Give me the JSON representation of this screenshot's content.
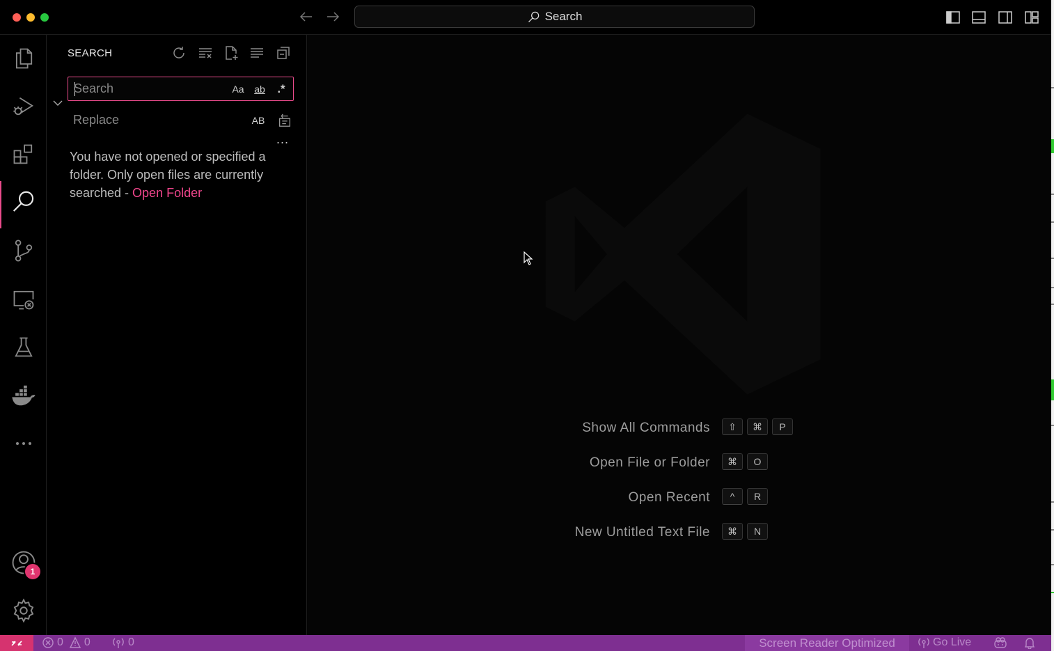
{
  "titlebar": {
    "command_center": "Search"
  },
  "activity_bar": {
    "items": [
      {
        "name": "explorer",
        "icon": "files-icon"
      },
      {
        "name": "run-debug",
        "icon": "debug-icon"
      },
      {
        "name": "extensions",
        "icon": "extensions-icon"
      },
      {
        "name": "search",
        "icon": "search-icon",
        "active": true
      },
      {
        "name": "source-control",
        "icon": "git-branch-icon"
      },
      {
        "name": "remote-explorer",
        "icon": "remote-icon"
      },
      {
        "name": "testing",
        "icon": "beaker-icon"
      },
      {
        "name": "docker",
        "icon": "docker-icon"
      },
      {
        "name": "more",
        "icon": "ellipsis-icon"
      }
    ],
    "accounts_badge": "1"
  },
  "sidebar": {
    "title": "SEARCH",
    "search": {
      "placeholder": "Search",
      "value": ""
    },
    "replace": {
      "placeholder": "Replace",
      "value": ""
    },
    "options": {
      "match_case": "Aa",
      "whole_word": "ab",
      "regex": ".*",
      "preserve_case": "AB"
    },
    "message_text": "You have not opened or specified a folder. Only open files are currently searched - ",
    "message_link": "Open Folder",
    "more": "..."
  },
  "editor": {
    "shortcuts": [
      {
        "label": "Show All Commands",
        "keys": [
          "⇧",
          "⌘",
          "P"
        ]
      },
      {
        "label": "Open File or Folder",
        "keys": [
          "⌘",
          "O"
        ]
      },
      {
        "label": "Open Recent",
        "keys": [
          "^",
          "R"
        ]
      },
      {
        "label": "New Untitled Text File",
        "keys": [
          "⌘",
          "N"
        ]
      }
    ]
  },
  "status_bar": {
    "errors": "0",
    "warnings": "0",
    "ports": "0",
    "screen_reader": "Screen Reader Optimized",
    "go_live": "Go Live"
  },
  "colors": {
    "accent": "#e94b8b",
    "status_bar": "#7e2f91",
    "remote": "#d6336f",
    "link": "#f0468c"
  }
}
